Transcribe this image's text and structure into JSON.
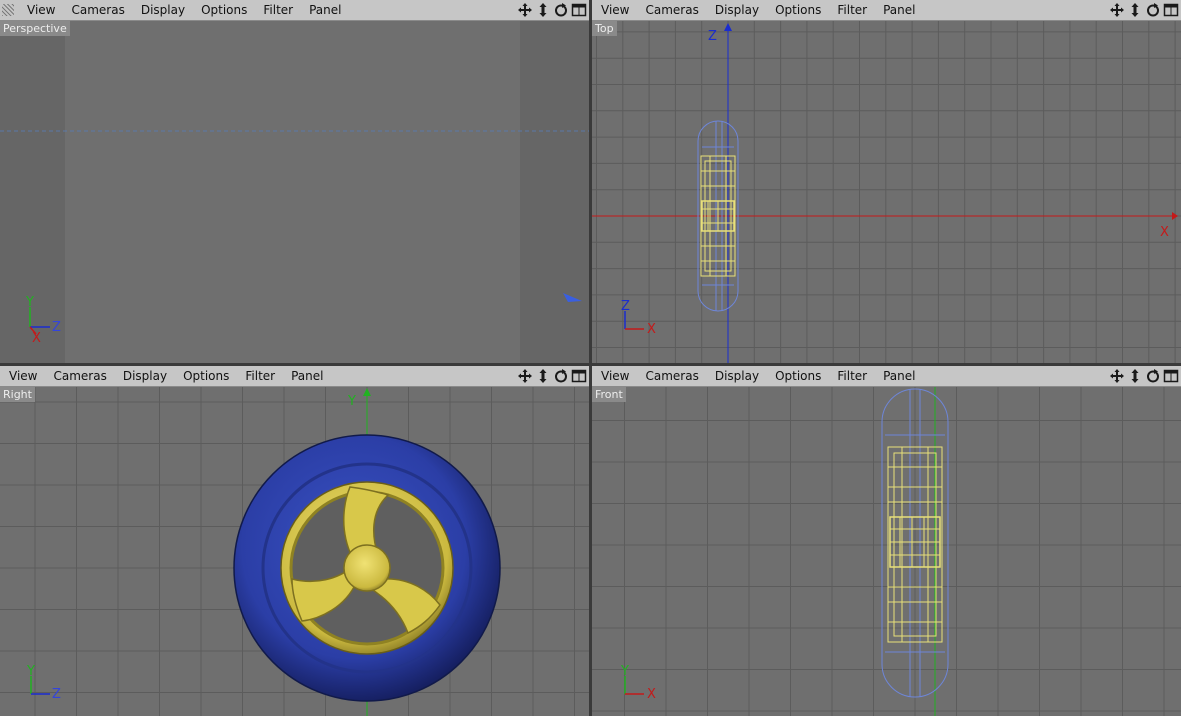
{
  "menu": {
    "items": [
      "View",
      "Cameras",
      "Display",
      "Options",
      "Filter",
      "Panel"
    ]
  },
  "viewports": {
    "perspective": {
      "label": "Perspective"
    },
    "top": {
      "label": "Top",
      "axis_v": "Z",
      "axis_h": "X"
    },
    "right": {
      "label": "Right",
      "axis_v": "Y"
    },
    "front": {
      "label": "Front"
    }
  },
  "gizmos": {
    "perspective": {
      "up": "Y",
      "side": "Z",
      "third": "X"
    },
    "top": {
      "up": "Z",
      "side": "X"
    },
    "right": {
      "up": "Y",
      "side": "Z"
    },
    "front": {
      "up": "Y",
      "side": "X"
    }
  },
  "icons": [
    "move-icon",
    "zoom-icon",
    "rotate-icon",
    "maximize-icon"
  ],
  "colors": {
    "menubar": "#c6c6c6",
    "viewport_bg": "#6f6f6f",
    "grid": "#5c5c5c",
    "tire": "#2c3e9e",
    "rim": "#d8c84a",
    "wire_yellow": "#e8e07a",
    "wire_blue": "#6e86d8",
    "axis_red": "#c41a1a",
    "axis_green": "#21b221",
    "axis_blue": "#1a2ccf"
  }
}
